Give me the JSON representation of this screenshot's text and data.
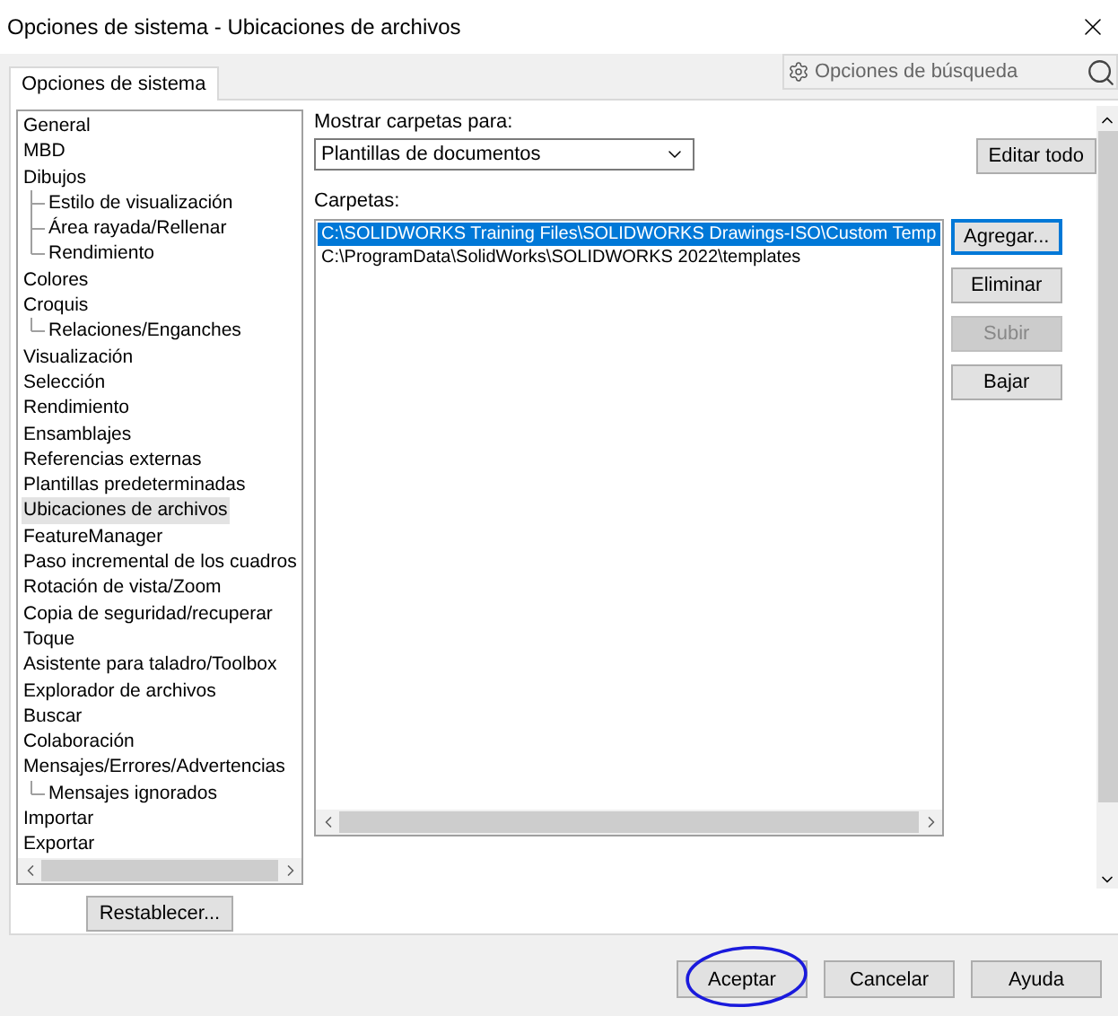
{
  "window": {
    "title": "Opciones de sistema - Ubicaciones de archivos"
  },
  "tabs": [
    {
      "label": "Opciones de sistema",
      "selected": true
    }
  ],
  "search": {
    "placeholder": "Opciones de búsqueda"
  },
  "tree": [
    {
      "label": "General",
      "selected": false
    },
    {
      "label": "MBD",
      "selected": false
    },
    {
      "label": "Dibujos",
      "selected": false,
      "children": [
        {
          "label": "Estilo de visualización",
          "selected": false
        },
        {
          "label": "Área rayada/Rellenar",
          "selected": false
        },
        {
          "label": "Rendimiento",
          "selected": false
        }
      ]
    },
    {
      "label": "Colores",
      "selected": false
    },
    {
      "label": "Croquis",
      "selected": false,
      "children": [
        {
          "label": "Relaciones/Enganches",
          "selected": false
        }
      ]
    },
    {
      "label": "Visualización",
      "selected": false
    },
    {
      "label": "Selección",
      "selected": false
    },
    {
      "label": "Rendimiento",
      "selected": false
    },
    {
      "label": "Ensamblajes",
      "selected": false
    },
    {
      "label": "Referencias externas",
      "selected": false
    },
    {
      "label": "Plantillas predeterminadas",
      "selected": false
    },
    {
      "label": "Ubicaciones de archivos",
      "selected": true
    },
    {
      "label": "FeatureManager",
      "selected": false
    },
    {
      "label": "Paso incremental de los cuadros",
      "selected": false
    },
    {
      "label": "Rotación de vista/Zoom",
      "selected": false
    },
    {
      "label": "Copia de seguridad/recuperar",
      "selected": false
    },
    {
      "label": "Toque",
      "selected": false
    },
    {
      "label": "Asistente para taladro/Toolbox",
      "selected": false
    },
    {
      "label": "Explorador de archivos",
      "selected": false
    },
    {
      "label": "Buscar",
      "selected": false
    },
    {
      "label": "Colaboración",
      "selected": false
    },
    {
      "label": "Mensajes/Errores/Advertencias",
      "selected": false,
      "children": [
        {
          "label": "Mensajes ignorados",
          "selected": false
        }
      ]
    },
    {
      "label": "Importar",
      "selected": false
    },
    {
      "label": "Exportar",
      "selected": false
    }
  ],
  "reset_button": "Restablecer...",
  "show_folders_for": {
    "label": "Mostrar carpetas para:",
    "value": "Plantillas de documentos"
  },
  "edit_all_button": "Editar todo",
  "folders": {
    "label": "Carpetas:",
    "items": [
      {
        "path": "C:\\SOLIDWORKS Training Files\\SOLIDWORKS Drawings-ISO\\Custom Temp",
        "selected": true
      },
      {
        "path": "C:\\ProgramData\\SolidWorks\\SOLIDWORKS 2022\\templates",
        "selected": false
      }
    ]
  },
  "folder_buttons": [
    {
      "label": "Agregar...",
      "disabled": false,
      "focused": true
    },
    {
      "label": "Eliminar",
      "disabled": false,
      "focused": false
    },
    {
      "label": "Subir",
      "disabled": true,
      "focused": false
    },
    {
      "label": "Bajar",
      "disabled": false,
      "focused": false
    }
  ],
  "footer_buttons": [
    {
      "label": "Aceptar",
      "circled": true
    },
    {
      "label": "Cancelar",
      "circled": false
    },
    {
      "label": "Ayuda",
      "circled": false
    }
  ]
}
